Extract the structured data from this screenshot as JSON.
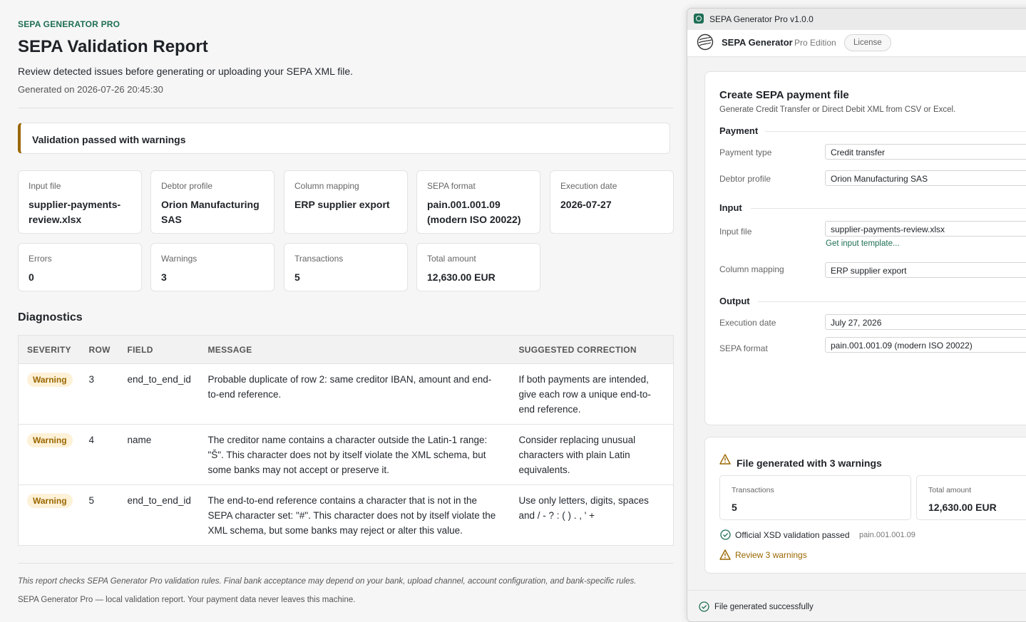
{
  "report": {
    "brand": "SEPA GENERATOR PRO",
    "title": "SEPA Validation Report",
    "subtitle": "Review detected issues before generating or uploading your SEPA XML file.",
    "generated": "Generated on 2026-07-26 20:45:30",
    "banner": "Validation passed with warnings",
    "summary": [
      {
        "label": "Input file",
        "value": "supplier-payments-review.xlsx"
      },
      {
        "label": "Debtor profile",
        "value": "Orion Manufacturing SAS"
      },
      {
        "label": "Column mapping",
        "value": "ERP supplier export"
      },
      {
        "label": "SEPA format",
        "value": "pain.001.001.09 (modern ISO 20022)"
      },
      {
        "label": "Execution date",
        "value": "2026-07-27"
      },
      {
        "label": "Errors",
        "value": "0"
      },
      {
        "label": "Warnings",
        "value": "3"
      },
      {
        "label": "Transactions",
        "value": "5"
      },
      {
        "label": "Total amount",
        "value": "12,630.00 EUR"
      }
    ],
    "diagnostics_title": "Diagnostics",
    "columns": [
      "SEVERITY",
      "ROW",
      "FIELD",
      "MESSAGE",
      "SUGGESTED CORRECTION"
    ],
    "rows": [
      {
        "severity": "Warning",
        "row": "3",
        "field": "end_to_end_id",
        "message": "Probable duplicate of row 2: same creditor IBAN, amount and end-to-end reference.",
        "correction": "If both payments are intended, give each row a unique end-to-end reference."
      },
      {
        "severity": "Warning",
        "row": "4",
        "field": "name",
        "message": "The creditor name contains a character outside the Latin-1 range: \"Š\". This character does not by itself violate the XML schema, but some banks may not accept or preserve it.",
        "correction": "Consider replacing unusual characters with plain Latin equivalents."
      },
      {
        "severity": "Warning",
        "row": "5",
        "field": "end_to_end_id",
        "message": "The end-to-end reference contains a character that is not in the SEPA character set: \"#\". This character does not by itself violate the XML schema, but some banks may reject or alter this value.",
        "correction": "Use only letters, digits, spaces and / - ? : ( ) . , ' +"
      }
    ],
    "note": "This report checks SEPA Generator Pro validation rules. Final bank acceptance may depend on your bank, upload channel, account configuration, and bank-specific rules.",
    "footer": "SEPA Generator Pro — local validation report. Your payment data never leaves this machine."
  },
  "app": {
    "window_title": "SEPA Generator Pro v1.0.0",
    "name": "SEPA Generator",
    "edition": "Pro Edition",
    "license": "License",
    "form": {
      "title": "Create SEPA payment file",
      "subtitle": "Generate Credit Transfer or Direct Debit XML from CSV or Excel.",
      "payment_group": "Payment",
      "payment_type_label": "Payment type",
      "payment_type_value": "Credit transfer",
      "debtor_label": "Debtor profile",
      "debtor_value": "Orion Manufacturing SAS",
      "input_group": "Input",
      "input_file_label": "Input file",
      "input_file_value": "supplier-payments-review.xlsx",
      "template_link": "Get input template...",
      "mapping_label": "Column mapping",
      "mapping_value": "ERP supplier export",
      "output_group": "Output",
      "exec_label": "Execution date",
      "exec_value": "July 27, 2026",
      "format_label": "SEPA format",
      "format_value": "pain.001.001.09 (modern ISO 20022)"
    },
    "result": {
      "title": "File generated with 3 warnings",
      "tx_label": "Transactions",
      "tx_value": "5",
      "amount_label": "Total amount",
      "amount_value": "12,630.00 EUR",
      "xsd_text": "Official XSD validation passed",
      "xsd_format": "pain.001.001.09",
      "review_text": "Review 3 warnings"
    },
    "status": "File generated successfully"
  },
  "colors": {
    "accent": "#1e6e55",
    "warning": "#9a6700",
    "warning_bg": "#fdf1d8"
  }
}
